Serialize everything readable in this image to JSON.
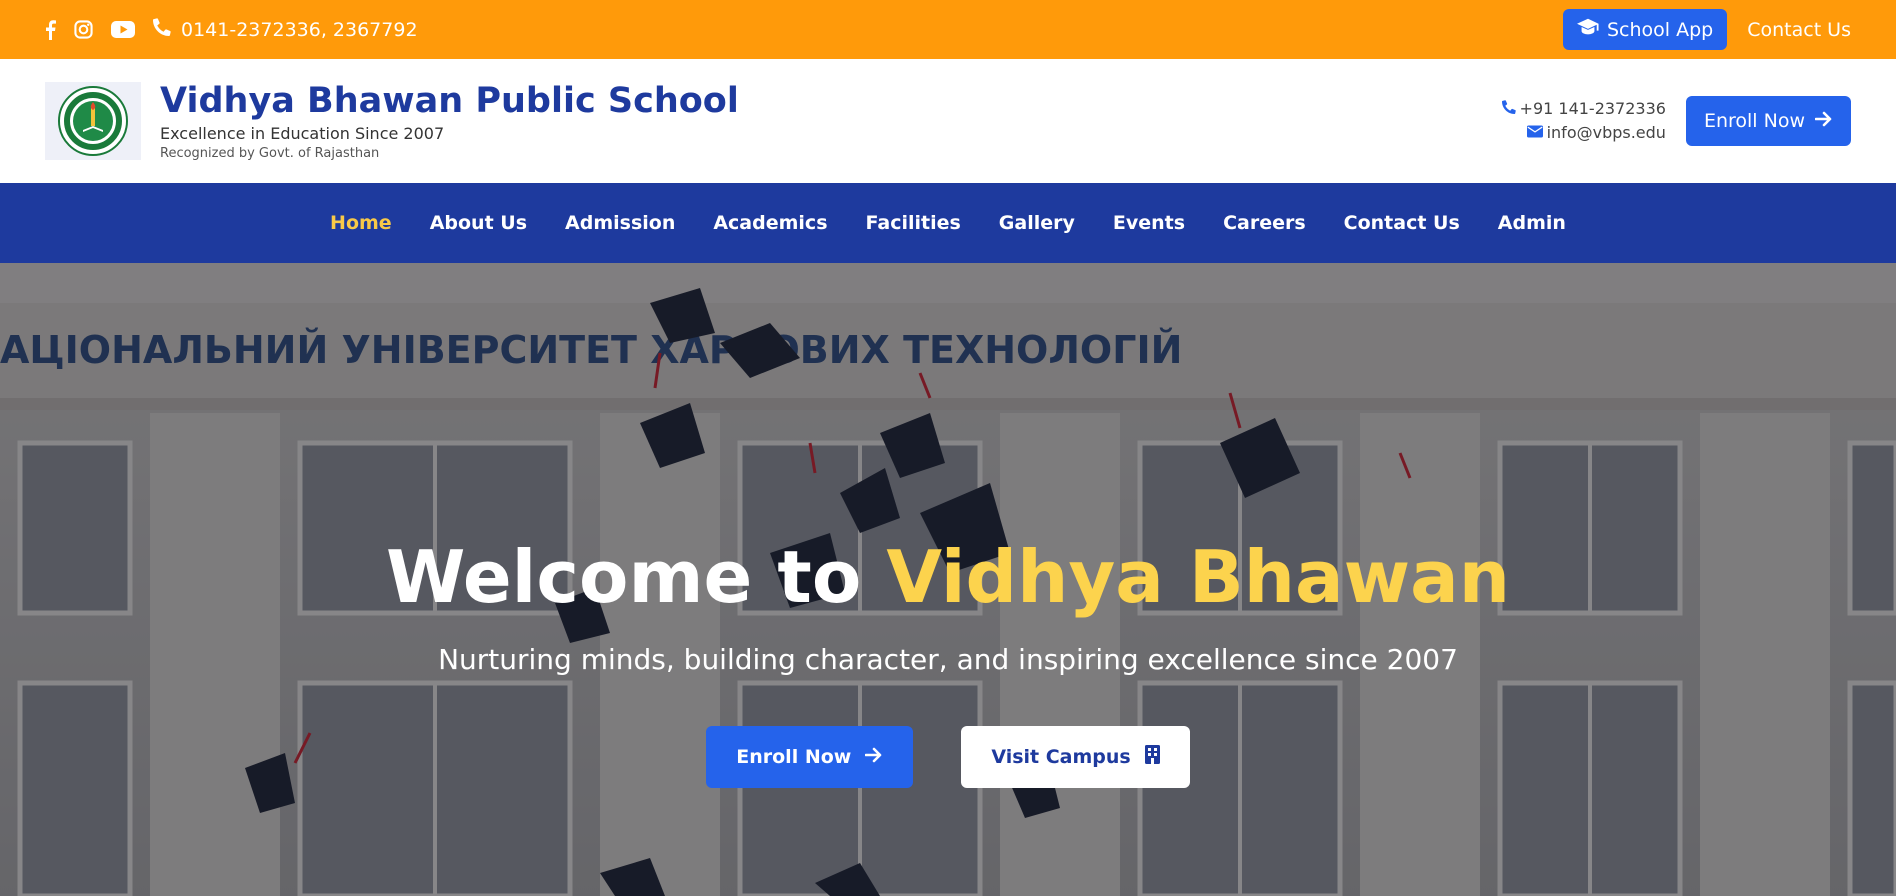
{
  "topbar": {
    "phone": "0141-2372336, 2367792",
    "school_app_label": "School App",
    "contact_label": "Contact Us",
    "bg_color": "#ff9a0a"
  },
  "header": {
    "school_name": "Vidhya Bhawan Public School",
    "tagline": "Excellence in Education Since 2007",
    "recognition": "Recognized by Govt. of Rajasthan",
    "phone": "+91 141-2372336",
    "email": "info@vbps.edu",
    "enroll_label": "Enroll Now"
  },
  "nav": {
    "items": [
      {
        "label": "Home"
      },
      {
        "label": "About Us"
      },
      {
        "label": "Admission"
      },
      {
        "label": "Academics"
      },
      {
        "label": "Facilities"
      },
      {
        "label": "Gallery"
      },
      {
        "label": "Events"
      },
      {
        "label": "Careers"
      },
      {
        "label": "Contact Us"
      },
      {
        "label": "Admin"
      }
    ],
    "active": "Home",
    "bg_color": "#1e3a9e"
  },
  "hero": {
    "title_prefix": "Welcome to ",
    "title_highlight": "Vidhya Bhawan",
    "subtitle": "Nurturing minds, building character, and inspiring excellence since 2007",
    "enroll_label": "Enroll Now",
    "visit_label": "Visit Campus",
    "building_sign": "АЦІОНАЛЬНИЙ УНІВЕРСИТЕТ ХАРЧОВИХ ТЕХНОЛОГІЙ",
    "highlight_color": "#fcd34d"
  },
  "icons": [
    "facebook-icon",
    "instagram-icon",
    "youtube-icon",
    "phone-icon",
    "graduation-cap-icon",
    "envelope-icon",
    "arrow-right-icon",
    "building-icon"
  ]
}
